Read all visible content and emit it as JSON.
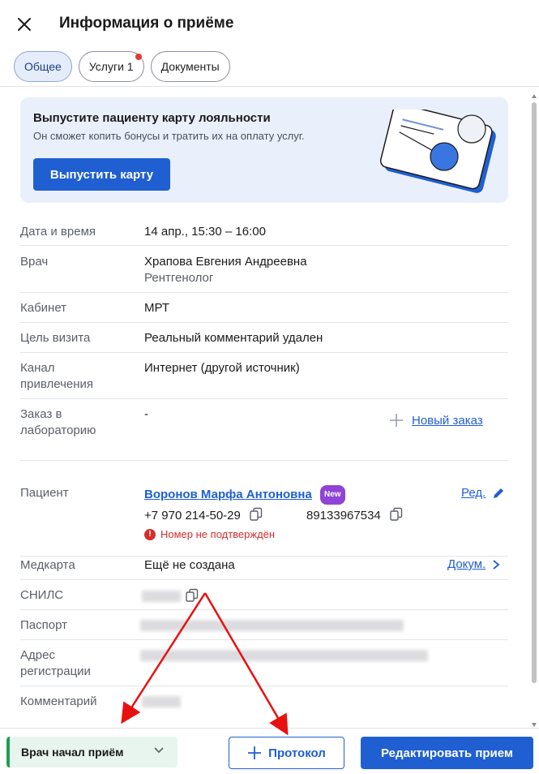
{
  "header": {
    "title": "Информация о приёме"
  },
  "tabs": [
    {
      "label": "Общее",
      "active": true
    },
    {
      "label": "Услуги 1",
      "has_dot": true
    },
    {
      "label": "Документы"
    }
  ],
  "promo": {
    "title": "Выпустите пациенту карту лояльности",
    "subtitle": "Он сможет копить бонусы и тратить их на оплату услуг.",
    "button": "Выпустить карту"
  },
  "details": {
    "datetime": {
      "label": "Дата и время",
      "value": "14 апр., 15:30 – 16:00"
    },
    "doctor": {
      "label": "Врач",
      "name": "Храпова Евгения Андреевна",
      "specialty": "Рентгенолог"
    },
    "room": {
      "label": "Кабинет",
      "value": "МРТ"
    },
    "purpose": {
      "label": "Цель визита",
      "value": "Реальный комментарий удален"
    },
    "channel": {
      "label_1": "Канал",
      "label_2": "привлечения",
      "value": "Интернет (другой источник)"
    },
    "lab": {
      "label_1": "Заказ в",
      "label_2": "лабораторию",
      "value": "-",
      "action": "Новый заказ"
    }
  },
  "patient": {
    "label": "Пациент",
    "name": "Воронов Марфа Антоновна",
    "badge": "New",
    "edit": "Ред.",
    "phone1": "+7 970 214-50-29",
    "phone2": "89133967534",
    "warning": "Номер не подтверждён",
    "medcard": {
      "label": "Медкарта",
      "value": "Ещё не создана",
      "action": "Докум."
    },
    "snils": {
      "label": "СНИЛС"
    },
    "passport": {
      "label": "Паспорт"
    },
    "address": {
      "label_1": "Адрес",
      "label_2": "регистрации"
    },
    "comment": {
      "label": "Комментарий"
    }
  },
  "footer": {
    "status": "Врач начал приём",
    "protocol": "Протокол",
    "edit": "Редактировать прием"
  },
  "colors": {
    "primary": "#1f5fd1",
    "success": "#1f9d55",
    "danger": "#d32f2f",
    "annotation": "#e8110f"
  }
}
